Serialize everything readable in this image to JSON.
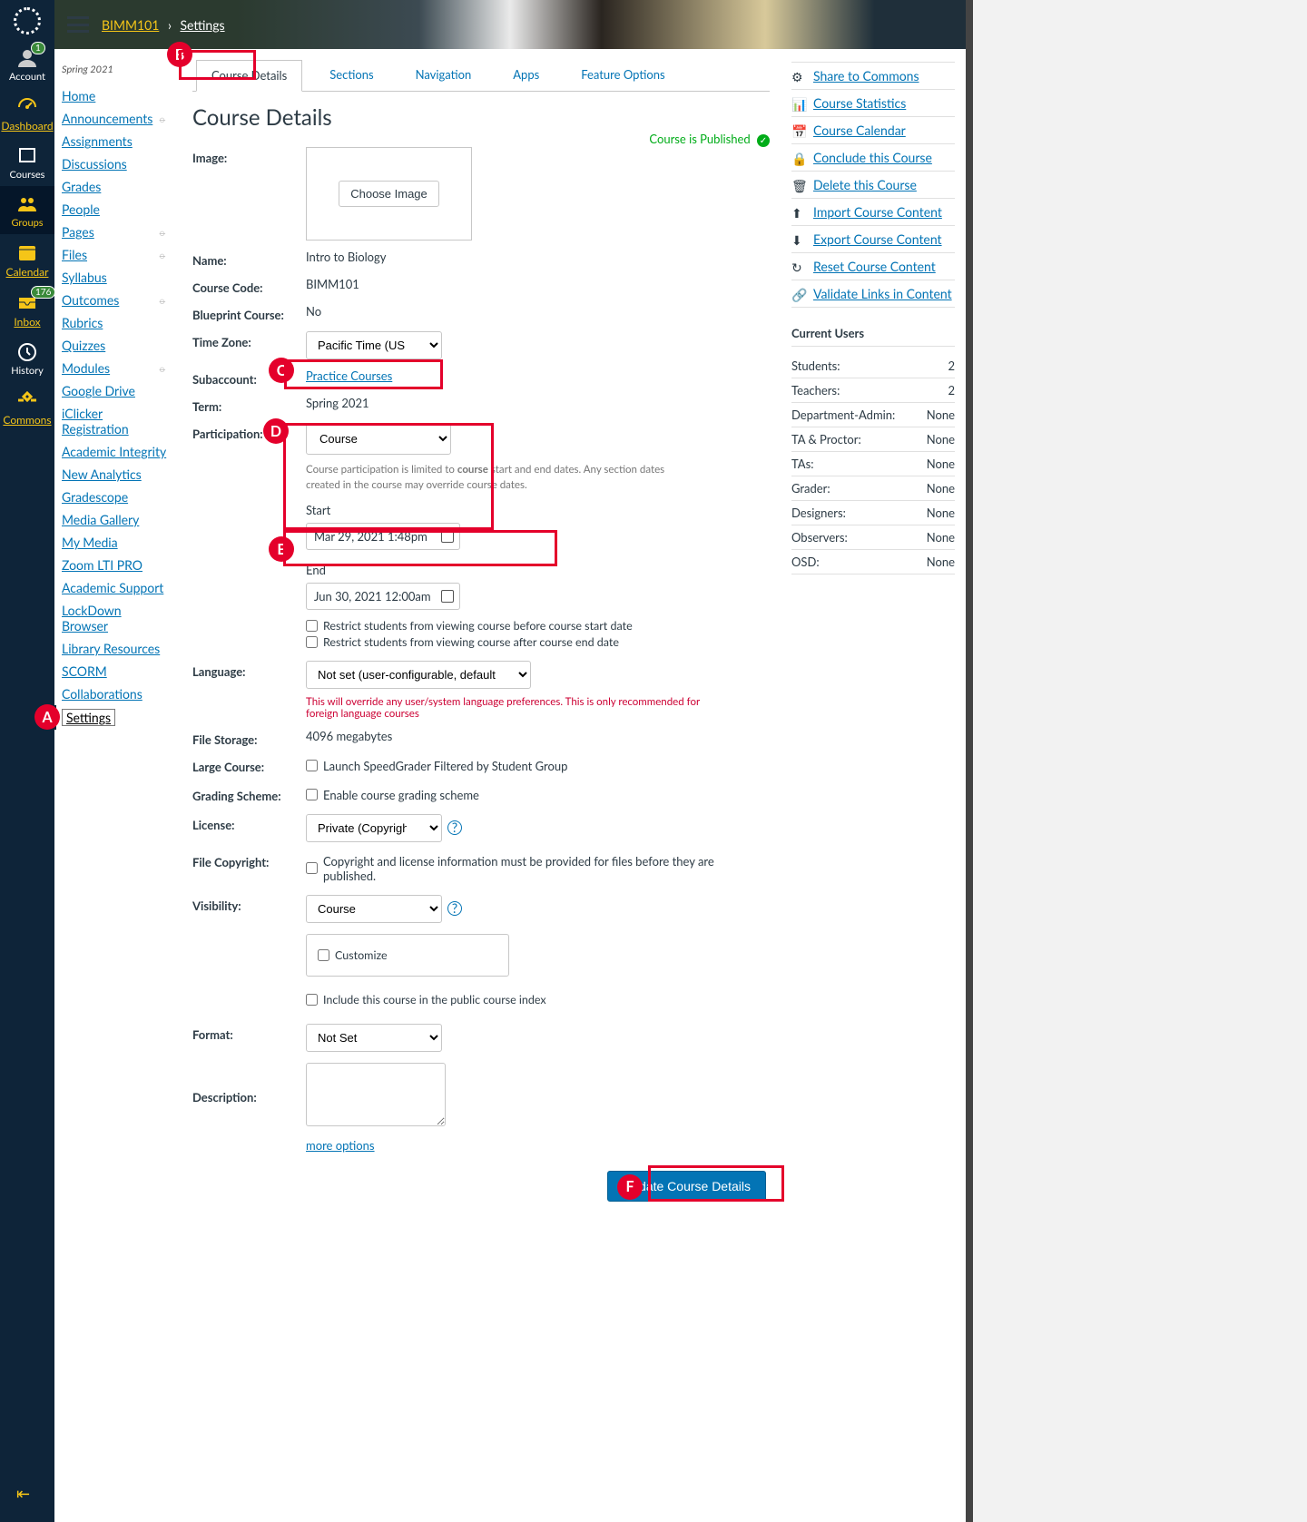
{
  "breadcrumb": {
    "course": "BIMM101",
    "page": "Settings"
  },
  "globalNav": {
    "account": "Account",
    "dashboard": "Dashboard",
    "courses": "Courses",
    "groups": "Groups",
    "calendar": "Calendar",
    "inbox": "Inbox",
    "history": "History",
    "commons": "Commons",
    "accountBadge": "1",
    "inboxBadge": "176"
  },
  "courseNav": {
    "term": "Spring 2021",
    "items": [
      {
        "label": "Home"
      },
      {
        "label": "Announcements",
        "hidden": true
      },
      {
        "label": "Assignments"
      },
      {
        "label": "Discussions"
      },
      {
        "label": "Grades"
      },
      {
        "label": "People"
      },
      {
        "label": "Pages",
        "hidden": true
      },
      {
        "label": "Files",
        "hidden": true
      },
      {
        "label": "Syllabus"
      },
      {
        "label": "Outcomes",
        "hidden": true
      },
      {
        "label": "Rubrics"
      },
      {
        "label": "Quizzes"
      },
      {
        "label": "Modules",
        "hidden": true
      },
      {
        "label": "Google Drive"
      },
      {
        "label": "iClicker Registration"
      },
      {
        "label": "Academic Integrity"
      },
      {
        "label": "New Analytics"
      },
      {
        "label": "Gradescope"
      },
      {
        "label": "Media Gallery"
      },
      {
        "label": "My Media"
      },
      {
        "label": "Zoom LTI PRO"
      },
      {
        "label": "Academic Support"
      },
      {
        "label": "LockDown Browser"
      },
      {
        "label": "Library Resources"
      },
      {
        "label": "SCORM"
      },
      {
        "label": "Collaborations"
      },
      {
        "label": "Settings",
        "active": true
      }
    ]
  },
  "tabs": [
    "Course Details",
    "Sections",
    "Navigation",
    "Apps",
    "Feature Options"
  ],
  "publishedText": "Course is Published",
  "title": "Course Details",
  "labels": {
    "image": "Image:",
    "name": "Name:",
    "code": "Course Code:",
    "blueprint": "Blueprint Course:",
    "tz": "Time Zone:",
    "subaccount": "Subaccount:",
    "term": "Term:",
    "participation": "Participation:",
    "start": "Start",
    "end": "End",
    "language": "Language:",
    "filestorage": "File Storage:",
    "large": "Large Course:",
    "grading": "Grading Scheme:",
    "license": "License:",
    "filecopy": "File Copyright:",
    "visibility": "Visibility:",
    "format": "Format:",
    "desc": "Description:"
  },
  "values": {
    "chooseImage": "Choose Image",
    "name": "Intro to Biology",
    "code": "BIMM101",
    "blueprint": "No",
    "tz": "Pacific Time (US & Canada) (",
    "subaccount": "Practice Courses",
    "term": "Spring 2021",
    "participation": "Course",
    "partHint1": "Course participation is limited to ",
    "partHint2": "course",
    "partHint3": " start and end dates. Any section dates created in the course may override course dates.",
    "start": "Mar 29, 2021 1:48pm",
    "end": "Jun 30, 2021 12:00am",
    "restrictBefore": "Restrict students from viewing course before course start date",
    "restrictAfter": "Restrict students from viewing course after course end date",
    "language": "Not set (user-configurable, defaults to English (US))",
    "langHint": "This will override any user/system language preferences. This is only recommended for foreign language courses",
    "filestorage": "4096 megabytes",
    "largeChk": "Launch SpeedGrader Filtered by Student Group",
    "gradingChk": "Enable course grading scheme",
    "license": "Private (Copyrighted)",
    "filecopyChk": "Copyright and license information must be provided for files before they are published.",
    "visibility": "Course",
    "customize": "Customize",
    "includePublic": "Include this course in the public course index",
    "format": "Not Set",
    "moreOptions": "more options",
    "update": "Update Course Details"
  },
  "sidebar": {
    "links": [
      "Share to Commons",
      "Course Statistics",
      "Course Calendar",
      "Conclude this Course",
      "Delete this Course",
      "Import Course Content",
      "Export Course Content",
      "Reset Course Content",
      "Validate Links in Content"
    ],
    "usersHeader": "Current Users",
    "users": [
      {
        "role": "Students:",
        "count": "2"
      },
      {
        "role": "Teachers:",
        "count": "2"
      },
      {
        "role": "Department-Admin:",
        "count": "None"
      },
      {
        "role": "TA & Proctor:",
        "count": "None"
      },
      {
        "role": "TAs:",
        "count": "None"
      },
      {
        "role": "Grader:",
        "count": "None"
      },
      {
        "role": "Designers:",
        "count": "None"
      },
      {
        "role": "Observers:",
        "count": "None"
      },
      {
        "role": "OSD:",
        "count": "None"
      }
    ]
  },
  "annotations": [
    "A",
    "B",
    "C",
    "D",
    "E",
    "F"
  ]
}
